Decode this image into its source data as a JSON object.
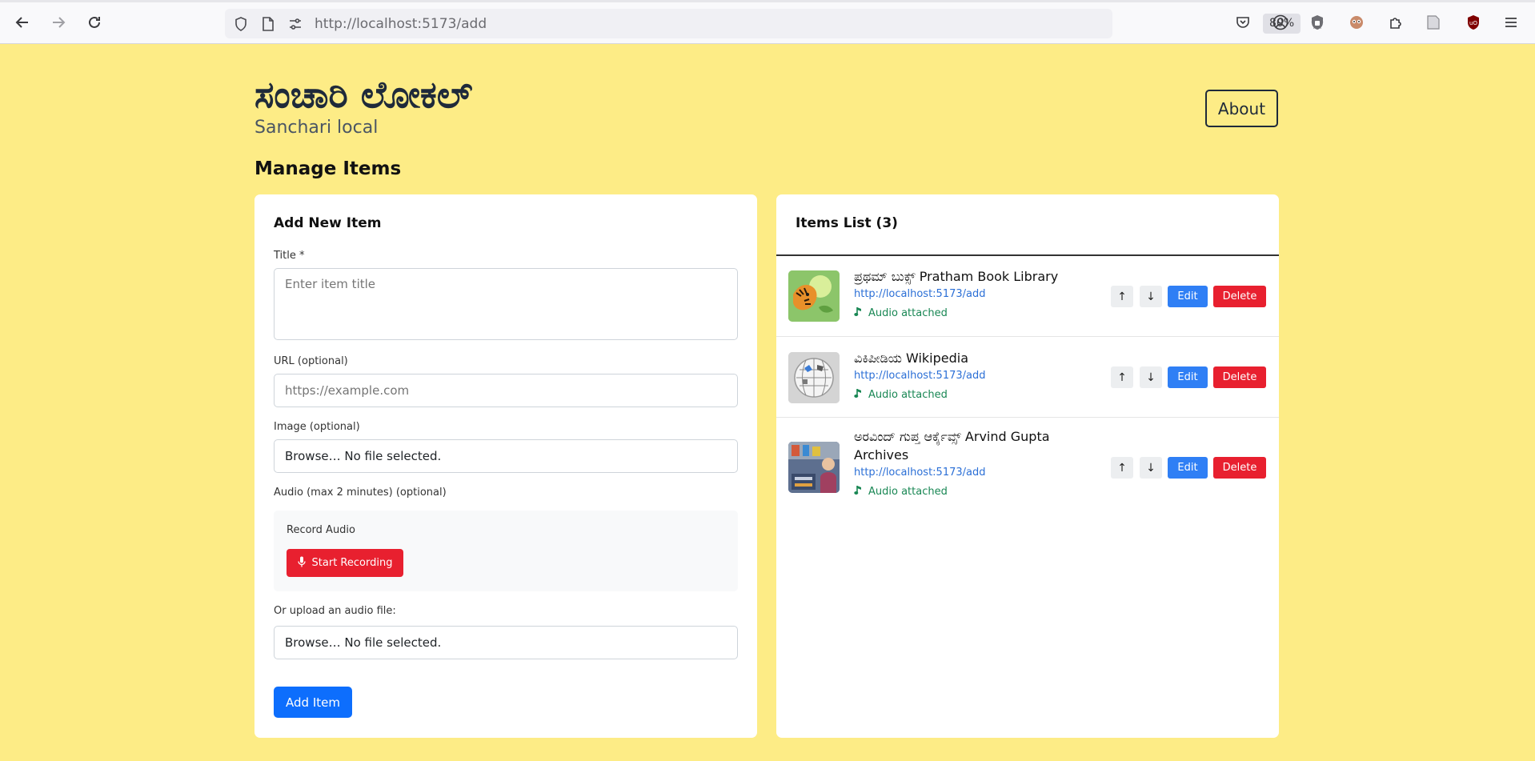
{
  "browser": {
    "url_host": "http://localhost",
    "url_rest": ":5173/add",
    "zoom": "80%"
  },
  "header": {
    "title_kannada": "ಸಂಚಾರಿ ಲೋಕಲ್",
    "subtitle": "Sanchari local",
    "about_label": "About"
  },
  "page_title": "Manage Items",
  "form": {
    "heading": "Add New Item",
    "title_label": "Title *",
    "title_placeholder": "Enter item title",
    "url_label": "URL (optional)",
    "url_placeholder": "https://example.com",
    "image_label": "Image (optional)",
    "file_text": "Browse… No file selected.",
    "audio_label": "Audio (max 2 minutes) (optional)",
    "record_label": "Record Audio",
    "record_button": "Start Recording",
    "upload_label": "Or upload an audio file:",
    "audio_file_text": "Browse… No file selected.",
    "submit_label": "Add Item"
  },
  "list": {
    "heading": "Items List (3)",
    "up_label": "↑",
    "down_label": "↓",
    "edit_label": "Edit",
    "delete_label": "Delete",
    "items": [
      {
        "title": "ಪ್ರಥಮ್ ಬುಕ್ಸ್ Pratham Book Library",
        "url": "http://localhost:5173/add",
        "audio": "Audio attached",
        "thumb": "tiger-illustration"
      },
      {
        "title": "ವಿಕಿಪೀಡಿಯ Wikipedia",
        "url": "http://localhost:5173/add",
        "audio": "Audio attached",
        "thumb": "wikipedia-globe"
      },
      {
        "title": "ಅರವಿಂದ್ ಗುಪ್ತ ಆರ್ಕೈವ್ಸ್ Arvind Gupta Archives",
        "url": "http://localhost:5173/add",
        "audio": "Audio attached",
        "thumb": "arvind-gupta-photo"
      }
    ]
  },
  "colors": {
    "page_bg": "#fdec86",
    "primary": "#0d6efd",
    "danger": "#e8202f",
    "success": "#198754"
  }
}
